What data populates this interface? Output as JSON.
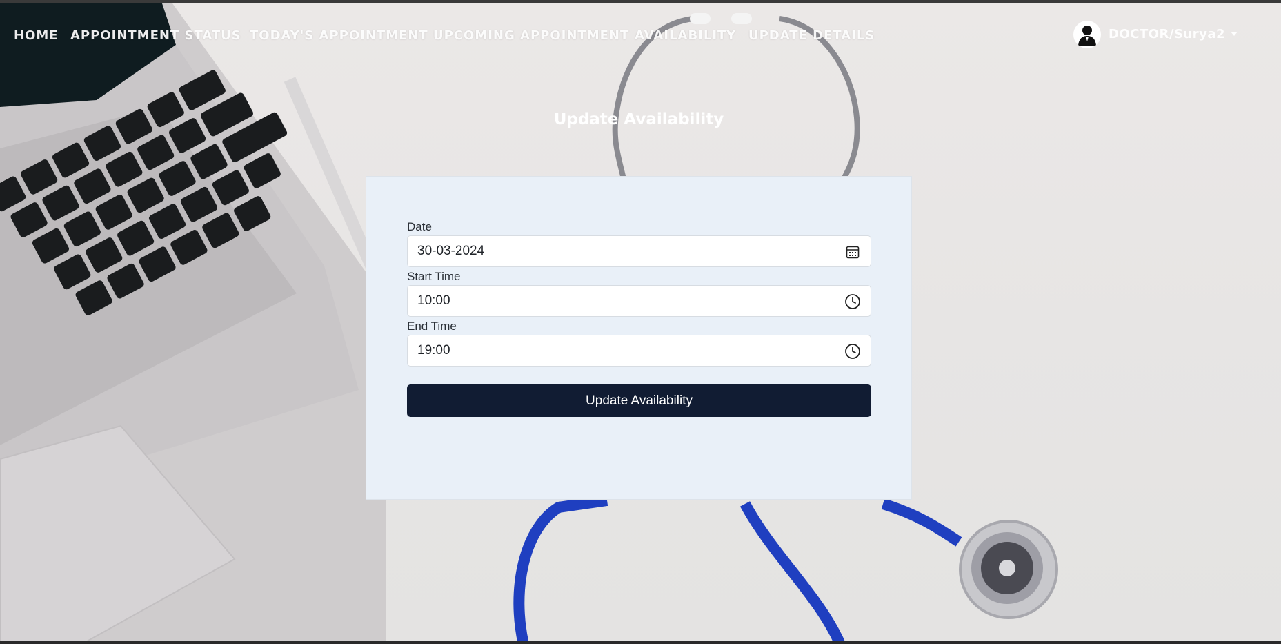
{
  "nav": {
    "items": [
      {
        "label": "HOME"
      },
      {
        "label": "APPOINTMENT STATUS"
      },
      {
        "label": "TODAY'S APPOINTMENT"
      },
      {
        "label": "UPCOMING APPOINTMENT"
      },
      {
        "label": "AVAILABILITY"
      },
      {
        "label": "UPDATE DETAILS"
      }
    ],
    "user": {
      "name": "DOCTOR/Surya2",
      "avatar_icon": "user-avatar-icon"
    }
  },
  "page": {
    "title": "Update Availability"
  },
  "form": {
    "date": {
      "label": "Date",
      "value": "30-03-2024",
      "icon": "calendar-icon"
    },
    "start_time": {
      "label": "Start Time",
      "value": "10:00",
      "icon": "clock-icon"
    },
    "end_time": {
      "label": "End Time",
      "value": "19:00",
      "icon": "clock-icon"
    },
    "submit_label": "Update Availability"
  },
  "colors": {
    "button_bg": "#111c33",
    "card_bg": "#e9f0f8",
    "stethoscope_tube": "#1f3fc0"
  }
}
